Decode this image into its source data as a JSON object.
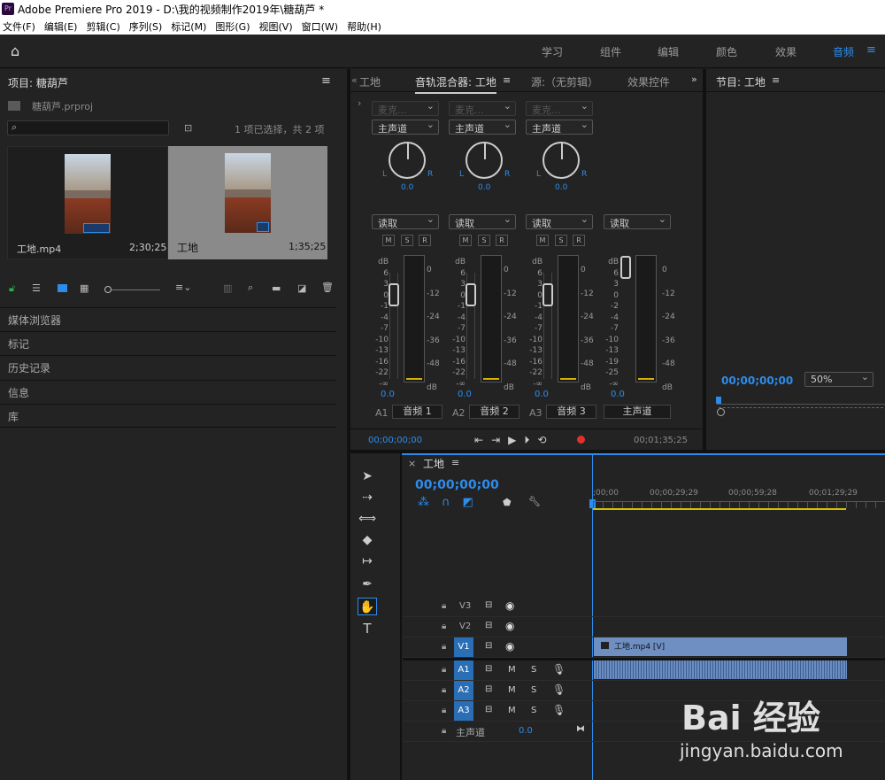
{
  "window": {
    "title": "Adobe Premiere Pro 2019 - D:\\我的视频制作2019年\\糖葫芦 *",
    "icon": "Pr"
  },
  "menu": [
    "文件(F)",
    "编辑(E)",
    "剪辑(C)",
    "序列(S)",
    "标记(M)",
    "图形(G)",
    "视图(V)",
    "窗口(W)",
    "帮助(H)"
  ],
  "workspaces": {
    "items": [
      "学习",
      "组件",
      "编辑",
      "颜色",
      "效果",
      "音频"
    ],
    "active": "音频"
  },
  "project": {
    "title": "项目: 糖葫芦",
    "file": "糖葫芦.prproj",
    "selection": "1 项已选择，共 2 项",
    "items": [
      {
        "name": "工地.mp4",
        "duration": "2;30;25"
      },
      {
        "name": "工地",
        "duration": "1;35;25"
      }
    ]
  },
  "left_panels": [
    "媒体浏览器",
    "标记",
    "历史记录",
    "信息",
    "库"
  ],
  "mixer": {
    "tabs": [
      "工地",
      "音轨混合器: 工地",
      "源:（无剪辑）",
      "效果控件"
    ],
    "channels": [
      {
        "input": "麦克...",
        "output": "主声道",
        "pan": "0.0",
        "mode": "读取",
        "level": "0.0",
        "id": "A1",
        "name": "音频 1"
      },
      {
        "input": "麦克...",
        "output": "主声道",
        "pan": "0.0",
        "mode": "读取",
        "level": "0.0",
        "id": "A2",
        "name": "音频 2"
      },
      {
        "input": "麦克...",
        "output": "主声道",
        "pan": "0.0",
        "mode": "读取",
        "level": "0.0",
        "id": "A3",
        "name": "音频 3"
      }
    ],
    "master": {
      "mode": "读取",
      "level": "0.0",
      "name": "主声道"
    },
    "fader_scale": [
      "dB",
      "6",
      "3",
      "0",
      "-1",
      "-4",
      "-7",
      "-10",
      "-13",
      "-16",
      "-22",
      "-∞"
    ],
    "meter_scale": [
      "0",
      "-12",
      "-24",
      "-36",
      "-48",
      "dB"
    ],
    "master_fader_scale": [
      "dB",
      "6",
      "3",
      "0",
      "-2",
      "-4",
      "-7",
      "-10",
      "-13",
      "-19",
      "-25",
      "-∞"
    ],
    "timecode_start": "00;00;00;00",
    "timecode_end": "00;01;35;25",
    "pan_l": "L",
    "pan_r": "R",
    "msr": [
      "M",
      "S",
      "R"
    ]
  },
  "program": {
    "title": "节目: 工地",
    "timecode": "00;00;00;00",
    "zoom": "50%"
  },
  "timeline": {
    "title": "工地",
    "timecode": "00;00;00;00",
    "ruler": [
      ";00;00",
      "00;00;29;29",
      "00;00;59;28",
      "00;01;29;29"
    ],
    "video_tracks": [
      "V3",
      "V2",
      "V1"
    ],
    "audio_tracks": [
      "A1",
      "A2",
      "A3"
    ],
    "master_label": "主声道",
    "master_value": "0.0",
    "video_clip": "工地.mp4 [V]",
    "track_letters": {
      "m": "M",
      "s": "S"
    }
  },
  "watermark": {
    "brand": "Bai 经验",
    "url": "jingyan.baidu.com"
  }
}
